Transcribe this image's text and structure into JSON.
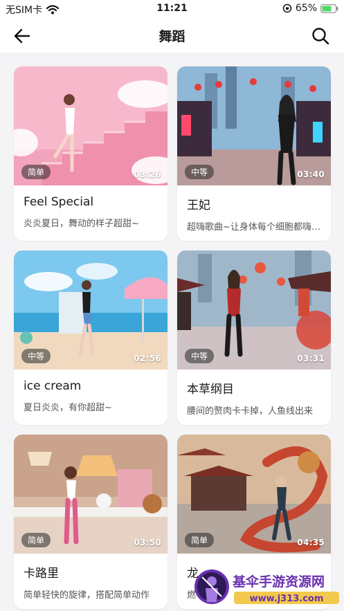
{
  "status_bar": {
    "carrier": "无SIM卡",
    "time": "11:21",
    "battery": "65%"
  },
  "header": {
    "title": "舞蹈"
  },
  "cards": [
    {
      "title": "Feel Special",
      "desc": "炎炎夏日，舞动的样子超甜~",
      "level": "简单",
      "duration": "03:26"
    },
    {
      "title": "王妃",
      "desc": "超嗨歌曲~让身体每个细胞都嗨起来",
      "level": "中等",
      "duration": "03:40"
    },
    {
      "title": "ice cream",
      "desc": "夏日炎炎，有你超甜~",
      "level": "中等",
      "duration": "02:56"
    },
    {
      "title": "本草纲目",
      "desc": "腰间的赘肉卡卡掉，人鱼线出来",
      "level": "中等",
      "duration": "03:31"
    },
    {
      "title": "卡路里",
      "desc": "简单轻快的旋律，搭配简单动作",
      "level": "简单",
      "duration": "03:50"
    },
    {
      "title": "龙",
      "desc": "燃",
      "level": "简单",
      "duration": "04:35"
    }
  ],
  "watermark": {
    "text": "基伞手游资源网",
    "url": "www.j313.com"
  }
}
